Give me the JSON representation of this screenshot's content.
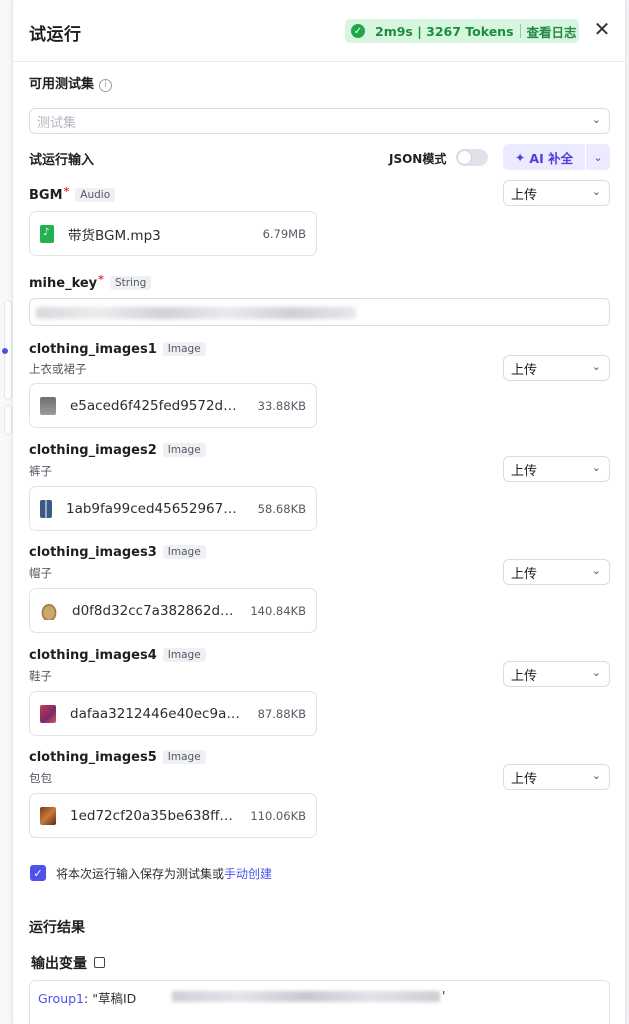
{
  "header": {
    "title": "试运行",
    "run_stats": "2m9s | 3267 Tokens",
    "view_logs": "查看日志"
  },
  "testset": {
    "label": "可用测试集",
    "placeholder": "测试集"
  },
  "run_input": {
    "label": "试运行输入",
    "json_mode_label": "JSON模式",
    "ai_fill_label": "AI 补全"
  },
  "upload_label": "上传",
  "fields": {
    "bgm": {
      "name": "BGM",
      "type": "Audio",
      "file_name": "带货BGM.mp3",
      "file_size": "6.79MB"
    },
    "mihe_key": {
      "name": "mihe_key",
      "type": "String"
    },
    "img1": {
      "name": "clothing_images1",
      "type": "Image",
      "desc": "上衣或裙子",
      "file_name": "e5aced6f425fed9572d…",
      "file_size": "33.88KB"
    },
    "img2": {
      "name": "clothing_images2",
      "type": "Image",
      "desc": "裤子",
      "file_name": "1ab9fa99ced45652967…",
      "file_size": "58.68KB"
    },
    "img3": {
      "name": "clothing_images3",
      "type": "Image",
      "desc": "帽子",
      "file_name": "d0f8d32cc7a382862d…",
      "file_size": "140.84KB"
    },
    "img4": {
      "name": "clothing_images4",
      "type": "Image",
      "desc": "鞋子",
      "file_name": "dafaa3212446e40ec9a…",
      "file_size": "87.88KB"
    },
    "img5": {
      "name": "clothing_images5",
      "type": "Image",
      "desc": "包包",
      "file_name": "1ed72cf20a35be638ff…",
      "file_size": "110.06KB"
    }
  },
  "save_option": {
    "text": "将本次运行输入保存为测试集或",
    "link": "手动创建"
  },
  "results": {
    "title": "运行结果",
    "output_title": "输出变量",
    "output_key": "Group1",
    "output_value_prefix": ": \"草稿ID",
    "output_value_suffix": "'"
  }
}
